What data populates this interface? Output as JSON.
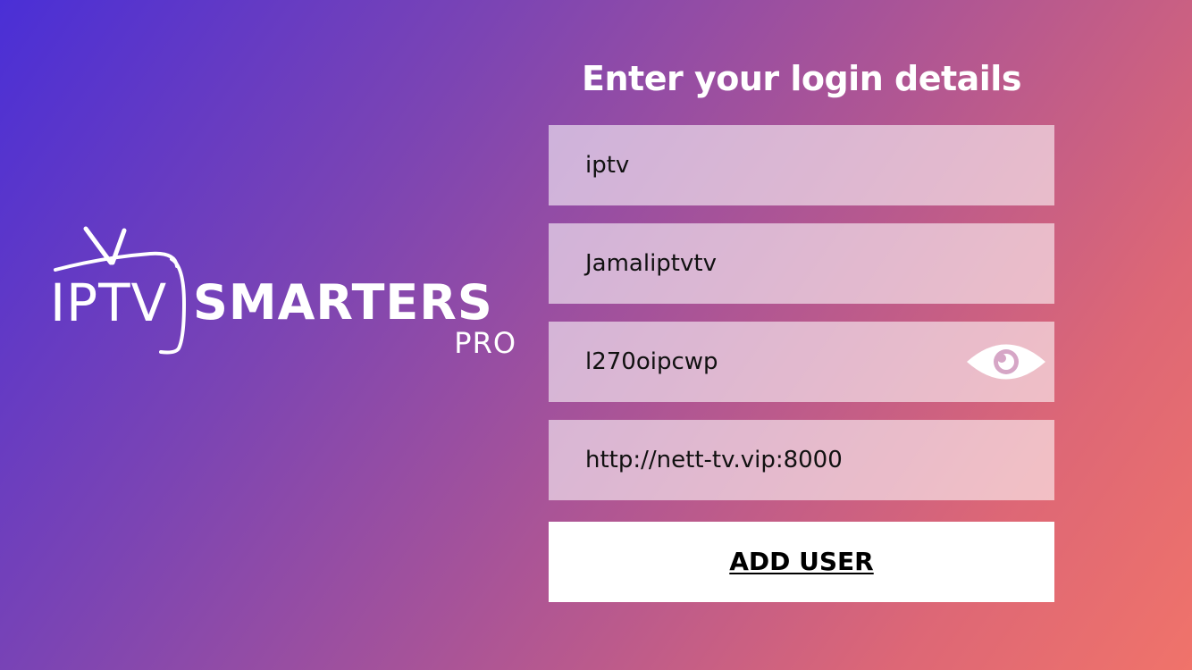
{
  "logo": {
    "iptv": "IPTV",
    "smarters": "SMARTERS",
    "pro": "PRO"
  },
  "form": {
    "title": "Enter your login details",
    "fields": [
      {
        "name": "username",
        "value": "iptv"
      },
      {
        "name": "any-name",
        "value": "Jamaliptvtv"
      },
      {
        "name": "password",
        "value": "l270oipcwp",
        "icon": "eye-icon"
      },
      {
        "name": "url",
        "value": "http://nett-tv.vip:8000"
      }
    ],
    "submit_label": "ADD USER"
  },
  "colors": {
    "gradient_start": "#4a2fd6",
    "gradient_end": "#f0736a",
    "eye_icon": "#ffffff",
    "button_bg": "#ffffff"
  }
}
